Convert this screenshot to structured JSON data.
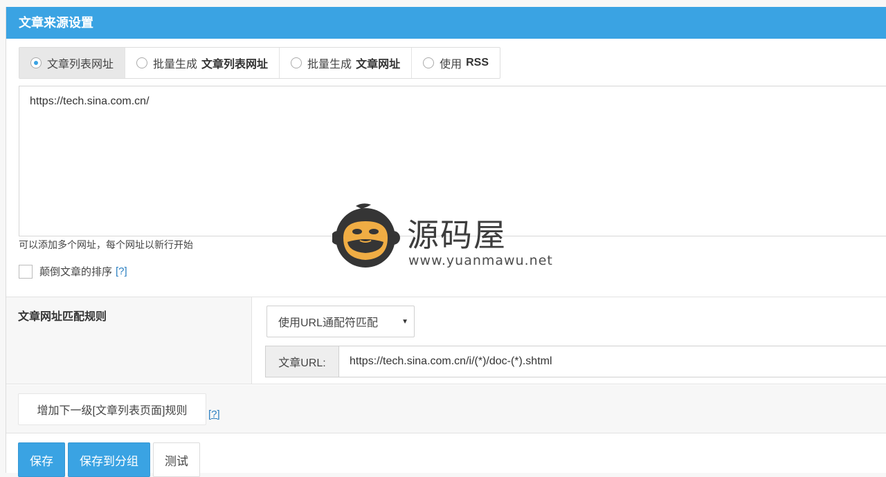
{
  "header": {
    "title": "文章来源设置"
  },
  "tabs": [
    {
      "label": "文章列表网址",
      "bold": "",
      "active": true
    },
    {
      "label": "批量生成",
      "bold": "文章列表网址",
      "active": false
    },
    {
      "label": "批量生成",
      "bold": "文章网址",
      "active": false
    },
    {
      "label": "使用",
      "bold": "RSS",
      "active": false
    }
  ],
  "list_urls": {
    "value": "https://tech.sina.com.cn/"
  },
  "hint": "可以添加多个网址，每个网址以新行开始",
  "reverse_order": {
    "label": "颠倒文章的排序",
    "help": "[?]",
    "checked": false
  },
  "rule": {
    "label": "文章网址匹配规则",
    "select_value": "使用URL通配符匹配",
    "url_addon": "文章URL:",
    "url_value": "https://tech.sina.com.cn/i/(*)/doc-(*).shtml"
  },
  "next_level": {
    "button_label": "增加下一级[文章列表页面]规则",
    "help": "[?]"
  },
  "buttons": {
    "save": "保存",
    "save_to_group": "保存到分组",
    "test": "测试"
  },
  "watermark": {
    "name": "源码屋",
    "url": "www.yuanmawu.net"
  },
  "colors": {
    "accent": "#3aa3e3",
    "link": "#2a7fc1"
  }
}
